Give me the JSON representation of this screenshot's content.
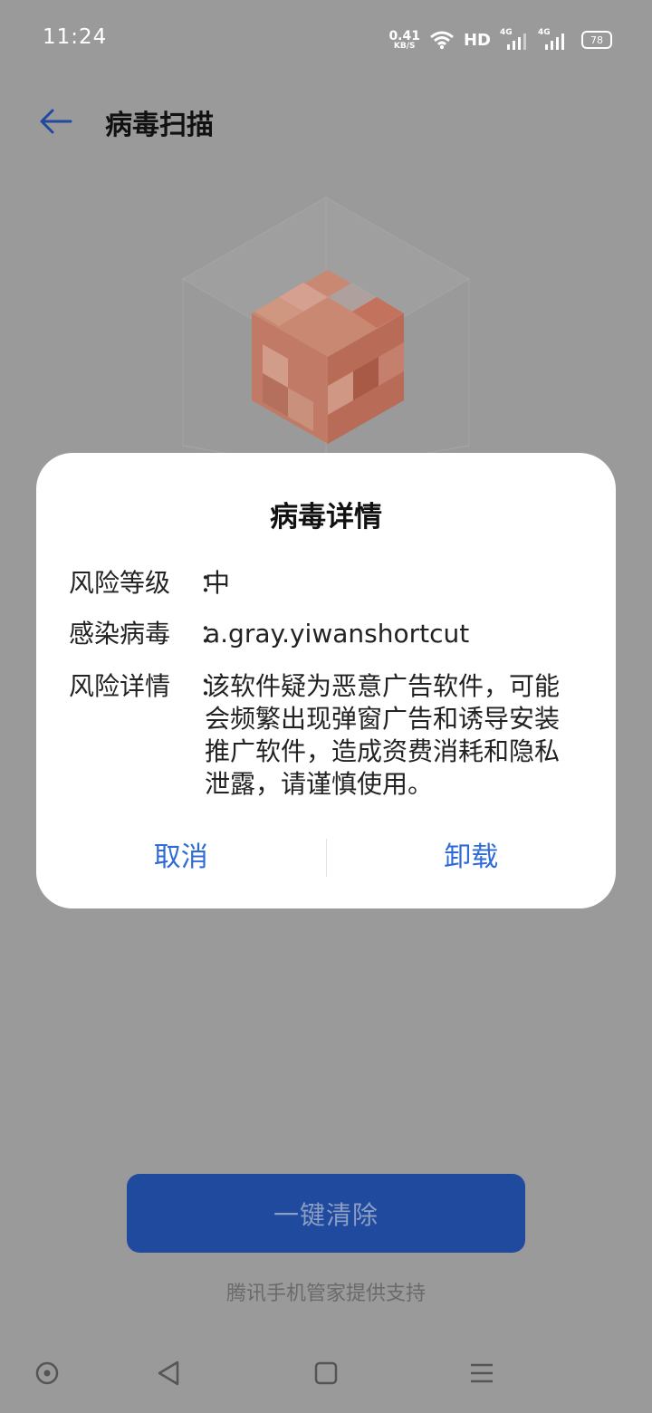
{
  "status_bar": {
    "time": "11:24",
    "net_speed_value": "0.41",
    "net_speed_unit": "KB/S",
    "hd_label": "HD",
    "signal_1_tag": "4G",
    "signal_2_tag": "4G",
    "battery": "78"
  },
  "header": {
    "title": "病毒扫描"
  },
  "dialog": {
    "title": "病毒详情",
    "risk_level_label": "风险等级",
    "risk_level_value": "中",
    "infected_label": "感染病毒",
    "infected_value": "a.gray.yiwanshortcut",
    "risk_detail_label": "风险详情",
    "risk_detail_value": "该软件疑为恶意广告软件，可能会频繁出现弹窗广告和诱导安装推广软件，造成资费消耗和隐私泄露，请谨慎使用。",
    "separator": "：",
    "cancel_label": "取消",
    "uninstall_label": "卸载"
  },
  "main": {
    "clean_button_label": "一键清除",
    "provider_text": "腾讯手机管家提供支持"
  },
  "colors": {
    "accent": "#2f6bd4",
    "primary_button": "#1f4a9e",
    "overlay": "#9a9a9a"
  }
}
